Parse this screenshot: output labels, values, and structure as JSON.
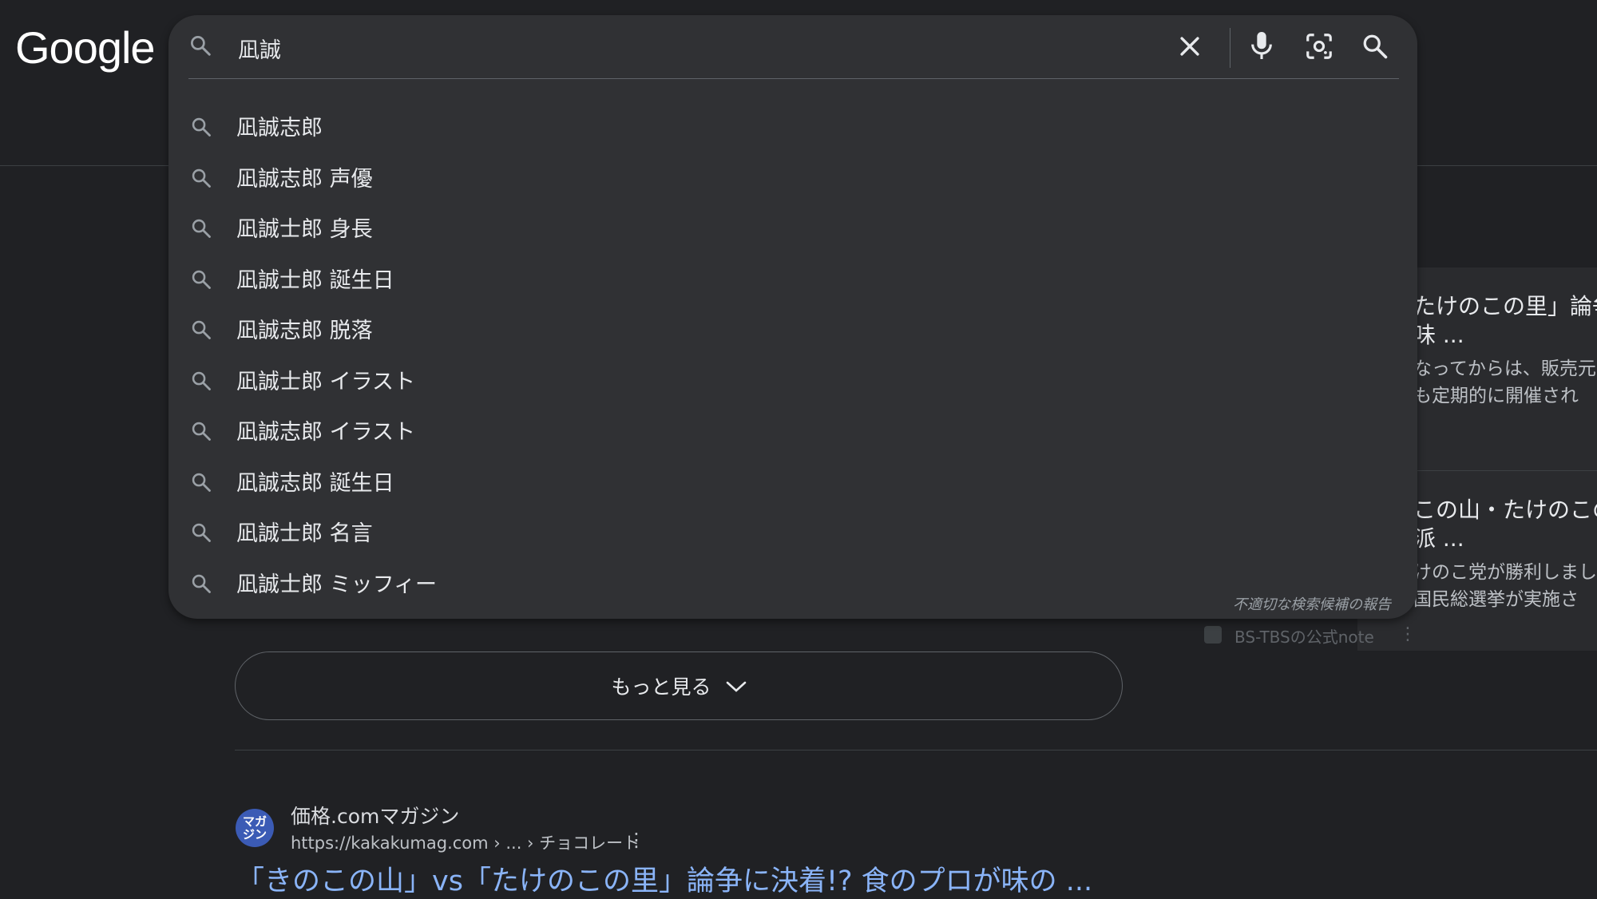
{
  "logo": "Google",
  "search": {
    "query": "凪誠",
    "suggestions": [
      "凪誠志郎",
      "凪誠志郎 声優",
      "凪誠士郎 身長",
      "凪誠士郎 誕生日",
      "凪誠志郎 脱落",
      "凪誠士郎 イラスト",
      "凪誠志郎 イラスト",
      "凪誠志郎 誕生日",
      "凪誠士郎 名言",
      "凪誠士郎 ミッフィー"
    ],
    "report_label": "不適切な検索候補の報告"
  },
  "right_panel": {
    "item1_title_1": "たけのこの里」論争",
    "item1_title_2": "味 ...",
    "item1_text_1": "なってからは、販売元",
    "item1_text_2": "も定期的に開催され",
    "item2_title_1": "この山・たけのこの",
    "item2_title_2": "派 ...",
    "item2_text_1": "けのこ党が勝利しまし",
    "item2_text_2": "国民総選挙が実施さ",
    "source": "BS-TBSの公式note"
  },
  "more_button": {
    "label": "もっと見る"
  },
  "result": {
    "favicon_text_1": "マガ",
    "favicon_text_2": "ジン",
    "site_name": "価格.comマガジン",
    "url": "https://kakakumag.com › ... › チョコレート",
    "title": "「きのこの山」vs「たけのこの里」論争に決着!? 食のプロが味の ..."
  },
  "colors": {
    "background": "#202124",
    "dropdown": "#303134",
    "link": "#8ab4f8"
  }
}
